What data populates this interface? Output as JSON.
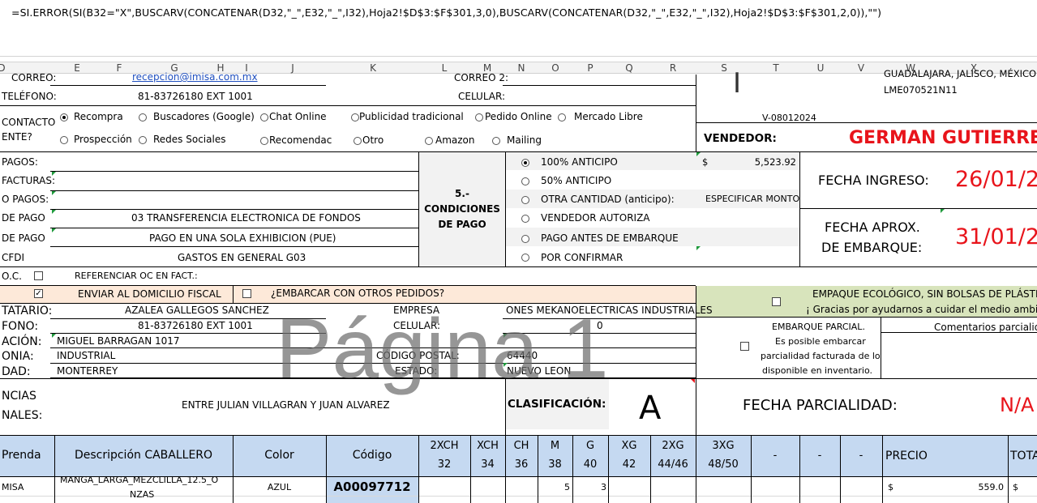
{
  "formula_bar": {
    "text": "=SI.ERROR(SI(B32=\"X\",BUSCARV(CONCATENAR(D32,\"_\",E32,\"_\",I32),Hoja2!$D$3:$F$301,3,0),BUSCARV(CONCATENAR(D32,\"_\",E32,\"_\",I32),Hoja2!$D$3:$F$301,2,0)),\"\")"
  },
  "columns": [
    "D",
    "E",
    "F",
    "G",
    "H",
    "I",
    "J",
    "K",
    "L",
    "M",
    "N",
    "O",
    "P",
    "Q",
    "R",
    "S",
    "T",
    "U",
    "V",
    "W",
    "X"
  ],
  "client": {
    "correo_label": "CORREO:",
    "correo_value": "recepcion@imisa.com.mx",
    "correo2_label": "CORREO 2:",
    "telefono_label": "TELÉFONO:",
    "telefono_value": "81-83726180 EXT 1001",
    "celular_label": "CELULAR:",
    "contacto_label1": "CONTACTO",
    "contacto_label2": "ENTE?",
    "options": [
      "Recompra",
      "Buscadores (Google)",
      "Chat Online",
      "Publicidad tradicional",
      "Pedido Online",
      "Mercado Libre",
      "Prospección",
      "Redes Sociales",
      "Recomendac",
      "Otro",
      "Amazon",
      "Mailing"
    ],
    "logo_mark": "I",
    "address_line": "GUADALAJARA, JALISCO, MÉXICO",
    "rfc": "LME070521N11",
    "folio": "V-08012024"
  },
  "vendedor": {
    "label": "VENDEDOR:",
    "value": "GERMAN GUTIERRE"
  },
  "pagos": {
    "labels": [
      "PAGOS:",
      "FACTURAS:",
      "O PAGOS:",
      "DE PAGO",
      "DE PAGO",
      "CFDI"
    ],
    "values": [
      "",
      "",
      "",
      "03 TRANSFERENCIA ELECTRONICA DE FONDOS",
      "PAGO EN UNA SOLA EXHIBICION (PUE)",
      "GASTOS EN GENERAL G03"
    ],
    "section_title": "5.- CONDICIONES DE PAGO",
    "section_title_l1": "5.-",
    "section_title_l2": "CONDICIONES",
    "section_title_l3": "DE PAGO",
    "conditions": [
      "100% ANTICIPO",
      "50% ANTICIPO",
      "OTRA CANTIDAD (anticipo):",
      "VENDEDOR AUTORIZA",
      "PAGO ANTES DE EMBARQUE",
      "POR CONFIRMAR"
    ],
    "currency": "$",
    "amount": "5,523.92",
    "especificar": "ESPECIFICAR MONTO"
  },
  "fechas": {
    "ingreso_label": "FECHA INGRESO:",
    "ingreso_value": "26/01/2",
    "embarque_label1": "FECHA APROX.",
    "embarque_label2": "DE EMBARQUE:",
    "embarque_value": "31/01/2"
  },
  "oc": {
    "label": "O.C.",
    "referenciar": "REFERENCIAR OC EN FACT.:"
  },
  "envio": {
    "domicilio": "ENVIAR AL DOMICILIO FISCAL",
    "otros": "¿EMBARCAR CON OTROS PEDIDOS?",
    "eco1": "EMPAQUE ECOLÓGICO, SIN BOLSAS DE PLÁSTICO",
    "eco2": "¡ Gracias por ayudarnos a cuidar el medio ambiente"
  },
  "destino": {
    "labels": [
      "TATARIO:",
      "FONO:",
      "ACIÓN:",
      "ONIA:",
      "DAD:"
    ],
    "destinatario": "AZALEA GALLEGOS SANCHEZ",
    "empresa_label": "EMPRESA",
    "empresa_value": "ONES MEKANOELECTRICAS INDUSTRIALES",
    "telefono": "81-83726180 EXT 1001",
    "celular_label": "CELULAR:",
    "celular_value": "0",
    "direccion": "MIGUEL BARRAGAN  1017",
    "colonia": "INDUSTRIAL",
    "cp_label": "CÓDIGO POSTAL:",
    "cp_value": "64440",
    "ciudad": "MONTERREY",
    "estado_label": "ESTADO:",
    "estado_value": "NUEVO LEON",
    "parcial1": "EMBARQUE PARCIAL.",
    "parcial2": "Es posible embarcar",
    "parcial3": "parcialidad facturada de lo",
    "parcial4": "disponible en inventario.",
    "comentarios": "Comentarios parcialida"
  },
  "referencias": {
    "label1": "NCIAS",
    "label2": "NALES:",
    "value": "ENTRE JULIAN VILLAGRAN Y JUAN ALVAREZ",
    "clasificacion_label": "CLASIFICACIÓN:",
    "clasificacion_value": "A",
    "parcialidad_label": "FECHA PARCIALIDAD:",
    "parcialidad_value": "N/A"
  },
  "watermark": "Página 1",
  "table": {
    "headers": {
      "prenda": "Prenda",
      "descripcion": "Descripción CABALLERO",
      "color": "Color",
      "codigo": "Código",
      "sizes": [
        [
          "2XCH",
          "32"
        ],
        [
          "XCH",
          "34"
        ],
        [
          "CH",
          "36"
        ],
        [
          "M",
          "38"
        ],
        [
          "G",
          "40"
        ],
        [
          "XG",
          "42"
        ],
        [
          "2XG",
          "44/46"
        ],
        [
          "3XG",
          "48/50"
        ],
        [
          "-",
          ""
        ],
        [
          "-",
          ""
        ],
        [
          "-",
          ""
        ]
      ],
      "precio": "PRECIO",
      "total": "TOTA"
    },
    "row": {
      "prenda": "MISA",
      "descripcion1": "MANGA_LARGA_MEZCLILLA_12.5_O",
      "descripcion2": "NZAS",
      "color": "AZUL",
      "codigo": "A00097712",
      "m": "5",
      "g": "3",
      "currency": "$",
      "precio": "559.0",
      "total_currency": "$"
    }
  },
  "colors": {
    "header_blue": "#c5d9f1",
    "eco_green": "#d8e4bc",
    "peach": "#fde9d9",
    "gray": "#f2f2f2",
    "accent_red": "#e8141b"
  }
}
